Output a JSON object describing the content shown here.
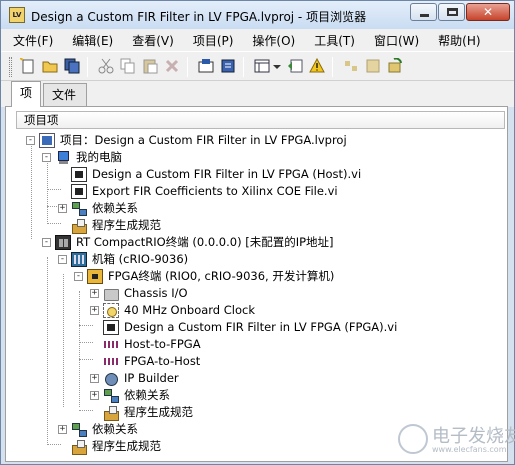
{
  "window": {
    "title": "Design a Custom FIR Filter in LV FPGA.lvproj - 项目浏览器",
    "app_icon_text": "LV"
  },
  "menu": [
    "文件(F)",
    "编辑(E)",
    "查看(V)",
    "项目(P)",
    "操作(O)",
    "工具(T)",
    "窗口(W)",
    "帮助(H)"
  ],
  "toolbar_icons": [
    "new-icon",
    "open-icon",
    "save-all-icon",
    "cut-icon",
    "copy-icon",
    "paste-icon",
    "delete-icon",
    "build-icon",
    "deploy-icon",
    "view-icon",
    "dropdown-icon",
    "add-icon",
    "warning-icon",
    "resolve-icon",
    "group-icon",
    "refresh-icon"
  ],
  "tabs": [
    "项",
    "文件"
  ],
  "tree": {
    "column_header": "项目项",
    "items": [
      {
        "label": "项目：Design a Custom FIR Filter in LV FPGA.lvproj",
        "icon": "project-icon",
        "expander": "-"
      },
      {
        "label": "我的电脑",
        "icon": "computer-icon",
        "expander": "-"
      },
      {
        "label": "Design a Custom FIR Filter in LV FPGA (Host).vi",
        "icon": "vi-icon",
        "expander": ""
      },
      {
        "label": "Export FIR Coefficients to Xilinx COE File.vi",
        "icon": "vi-icon",
        "expander": ""
      },
      {
        "label": "依赖关系",
        "icon": "dependencies-icon",
        "expander": "+"
      },
      {
        "label": "程序生成规范",
        "icon": "build-spec-icon",
        "expander": ""
      },
      {
        "label": "RT CompactRIO终端 (0.0.0.0) [未配置的IP地址]",
        "icon": "crio-icon",
        "expander": "-"
      },
      {
        "label": "机箱 (cRIO-9036)",
        "icon": "chassis-icon",
        "expander": "-"
      },
      {
        "label": "FPGA终端 (RIO0, cRIO-9036, 开发计算机)",
        "icon": "fpga-icon",
        "expander": "-"
      },
      {
        "label": "Chassis I/O",
        "icon": "folder-icon",
        "expander": "+"
      },
      {
        "label": "40 MHz Onboard Clock",
        "icon": "clock-icon",
        "expander": "+"
      },
      {
        "label": "Design a Custom FIR Filter in LV FPGA (FPGA).vi",
        "icon": "vi-icon",
        "expander": ""
      },
      {
        "label": "Host-to-FPGA",
        "icon": "fifo-icon",
        "expander": ""
      },
      {
        "label": "FPGA-to-Host",
        "icon": "fifo-icon",
        "expander": ""
      },
      {
        "label": "IP Builder",
        "icon": "ip-builder-icon",
        "expander": "+"
      },
      {
        "label": "依赖关系",
        "icon": "dependencies-icon",
        "expander": "+"
      },
      {
        "label": "程序生成规范",
        "icon": "build-spec-icon",
        "expander": ""
      },
      {
        "label": "依赖关系",
        "icon": "dependencies-icon",
        "expander": "+"
      },
      {
        "label": "程序生成规范",
        "icon": "build-spec-icon",
        "expander": ""
      }
    ]
  },
  "watermark": {
    "text": "电子发烧友",
    "url": "www.elecfans.com"
  }
}
